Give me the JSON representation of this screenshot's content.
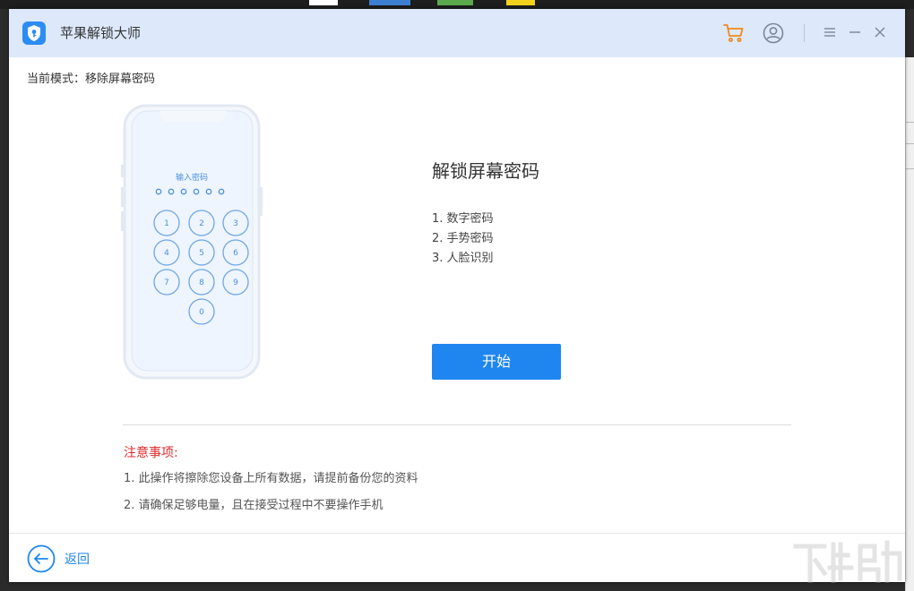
{
  "app": {
    "title": "苹果解锁大师"
  },
  "mode": {
    "text": "当前模式：移除屏幕密码"
  },
  "phone": {
    "prompt": "输入密码",
    "keys": [
      "1",
      "2",
      "3",
      "4",
      "5",
      "6",
      "7",
      "8",
      "9",
      "0"
    ]
  },
  "info": {
    "title": "解锁屏幕密码",
    "items": [
      "1. 数字密码",
      "2. 手势密码",
      "3. 人脸识别"
    ],
    "start_label": "开始"
  },
  "notes": {
    "title": "注意事项:",
    "items": [
      "1. 此操作将擦除您设备上所有数据，请提前备份您的资料",
      "2. 请确保足够电量，且在接受过程中不要操作手机"
    ]
  },
  "footer": {
    "back_label": "返回"
  },
  "colors": {
    "accent": "#1f86f0",
    "titlebar": "#dde9fb",
    "cart": "#f08a1c",
    "warning": "#e02b2b"
  },
  "icons": [
    "app-logo-icon",
    "cart-icon",
    "user-icon",
    "menu-icon",
    "minimize-icon",
    "close-icon",
    "back-arrow-icon"
  ]
}
